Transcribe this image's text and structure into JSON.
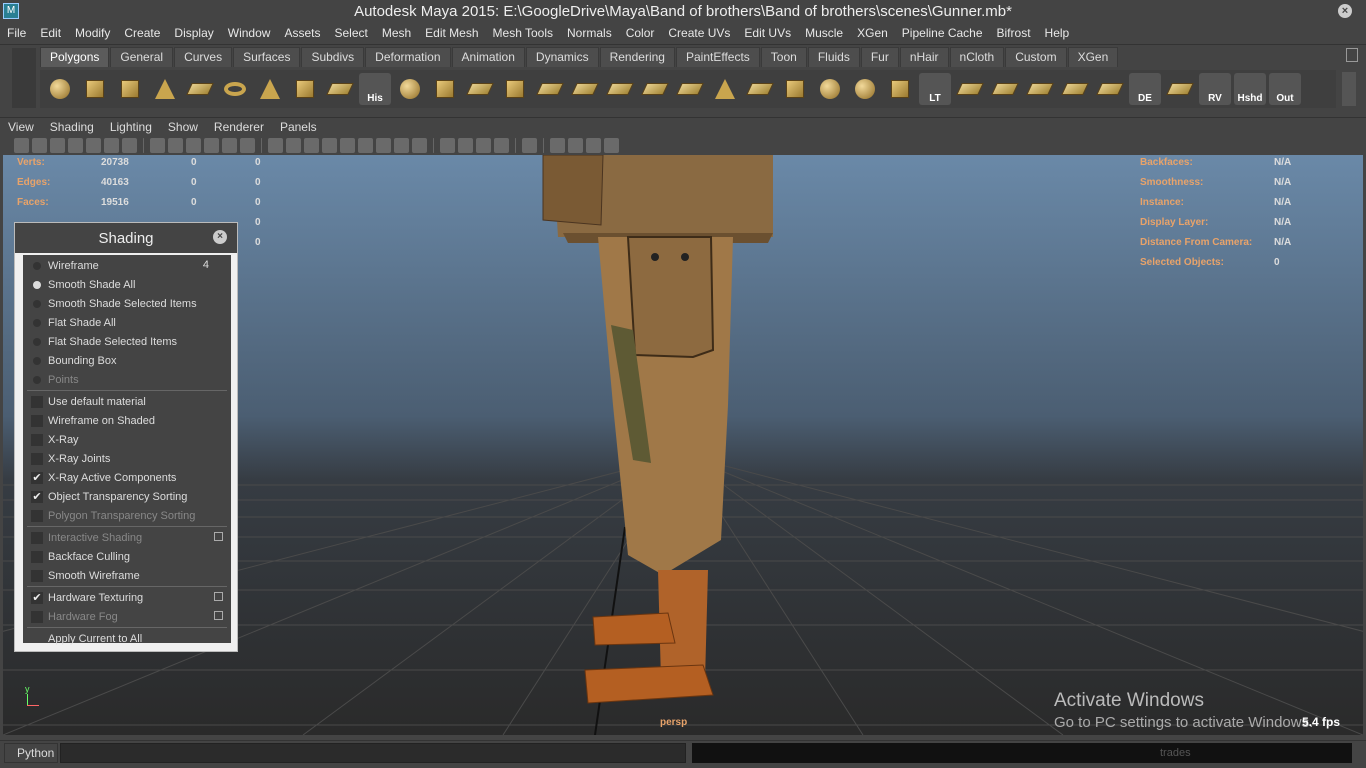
{
  "window": {
    "title": "Autodesk Maya 2015: E:\\GoogleDrive\\Maya\\Band of brothers\\Band of brothers\\scenes\\Gunner.mb*",
    "icon": "maya-app-icon"
  },
  "menubar": [
    "File",
    "Edit",
    "Modify",
    "Create",
    "Display",
    "Window",
    "Assets",
    "Select",
    "Mesh",
    "Edit Mesh",
    "Mesh Tools",
    "Normals",
    "Color",
    "Create UVs",
    "Edit UVs",
    "Muscle",
    "XGen",
    "Pipeline Cache",
    "Bifrost",
    "Help"
  ],
  "shelf": {
    "tabs": [
      "Polygons",
      "General",
      "Curves",
      "Surfaces",
      "Subdivs",
      "Deformation",
      "Animation",
      "Dynamics",
      "Rendering",
      "PaintEffects",
      "Toon",
      "Fluids",
      "Fur",
      "nHair",
      "nCloth",
      "Custom",
      "XGen"
    ],
    "active_tab": "Polygons",
    "labeled_icons": {
      "his": "His",
      "lt": "LT",
      "de": "DE",
      "rv": "RV",
      "hshd": "Hshd",
      "out": "Out"
    }
  },
  "panel_menu": [
    "View",
    "Shading",
    "Lighting",
    "Show",
    "Renderer",
    "Panels"
  ],
  "hud_left": [
    {
      "label": "Verts:",
      "v1": "20738",
      "v2": "0",
      "v3": "0"
    },
    {
      "label": "Edges:",
      "v1": "40163",
      "v2": "0",
      "v3": "0"
    },
    {
      "label": "Faces:",
      "v1": "19516",
      "v2": "0",
      "v3": "0"
    },
    {
      "label": "",
      "v1": "",
      "v2": "",
      "v3": "0"
    },
    {
      "label": "",
      "v1": "",
      "v2": "",
      "v3": "0"
    }
  ],
  "hud_right": [
    {
      "label": "Backfaces:",
      "value": "N/A"
    },
    {
      "label": "Smoothness:",
      "value": "N/A"
    },
    {
      "label": "Instance:",
      "value": "N/A"
    },
    {
      "label": "Display Layer:",
      "value": "N/A"
    },
    {
      "label": "Distance From Camera:",
      "value": "N/A"
    },
    {
      "label": "Selected Objects:",
      "value": "0"
    }
  ],
  "shading_panel": {
    "title": "Shading",
    "radio_items": [
      {
        "label": "Wireframe",
        "hotkey": "4",
        "selected": false,
        "enabled": true
      },
      {
        "label": "Smooth Shade All",
        "hotkey": "",
        "selected": true,
        "enabled": true
      },
      {
        "label": "Smooth Shade Selected Items",
        "hotkey": "",
        "selected": false,
        "enabled": true
      },
      {
        "label": "Flat Shade All",
        "hotkey": "",
        "selected": false,
        "enabled": true
      },
      {
        "label": "Flat Shade Selected Items",
        "hotkey": "",
        "selected": false,
        "enabled": true
      },
      {
        "label": "Bounding Box",
        "hotkey": "",
        "selected": false,
        "enabled": true
      },
      {
        "label": "Points",
        "hotkey": "",
        "selected": false,
        "enabled": false
      }
    ],
    "check_items_1": [
      {
        "label": "Use default material",
        "checked": false,
        "enabled": true
      },
      {
        "label": "Wireframe on Shaded",
        "checked": false,
        "enabled": true
      },
      {
        "label": "X-Ray",
        "checked": false,
        "enabled": true
      },
      {
        "label": "X-Ray Joints",
        "checked": false,
        "enabled": true
      },
      {
        "label": "X-Ray Active Components",
        "checked": true,
        "enabled": true
      },
      {
        "label": "Object Transparency Sorting",
        "checked": true,
        "enabled": true
      },
      {
        "label": "Polygon Transparency Sorting",
        "checked": false,
        "enabled": false
      }
    ],
    "check_items_2": [
      {
        "label": "Interactive Shading",
        "checked": false,
        "enabled": false,
        "has_option": true
      },
      {
        "label": "Backface Culling",
        "checked": false,
        "enabled": true,
        "has_option": false
      },
      {
        "label": "Smooth Wireframe",
        "checked": false,
        "enabled": true,
        "has_option": false
      }
    ],
    "check_items_3": [
      {
        "label": "Hardware Texturing",
        "checked": true,
        "enabled": true,
        "has_option": true
      },
      {
        "label": "Hardware Fog",
        "checked": false,
        "enabled": false,
        "has_option": true
      }
    ],
    "apply_label": "Apply Current to All"
  },
  "viewport": {
    "camera": "persp",
    "fps": "5.4 fps",
    "axis_y": "y"
  },
  "watermark": {
    "title": "Activate Windows",
    "subtitle": "Go to PC settings to activate Windows."
  },
  "cmdline": {
    "mode": "Python",
    "input": "",
    "result": "trades"
  }
}
